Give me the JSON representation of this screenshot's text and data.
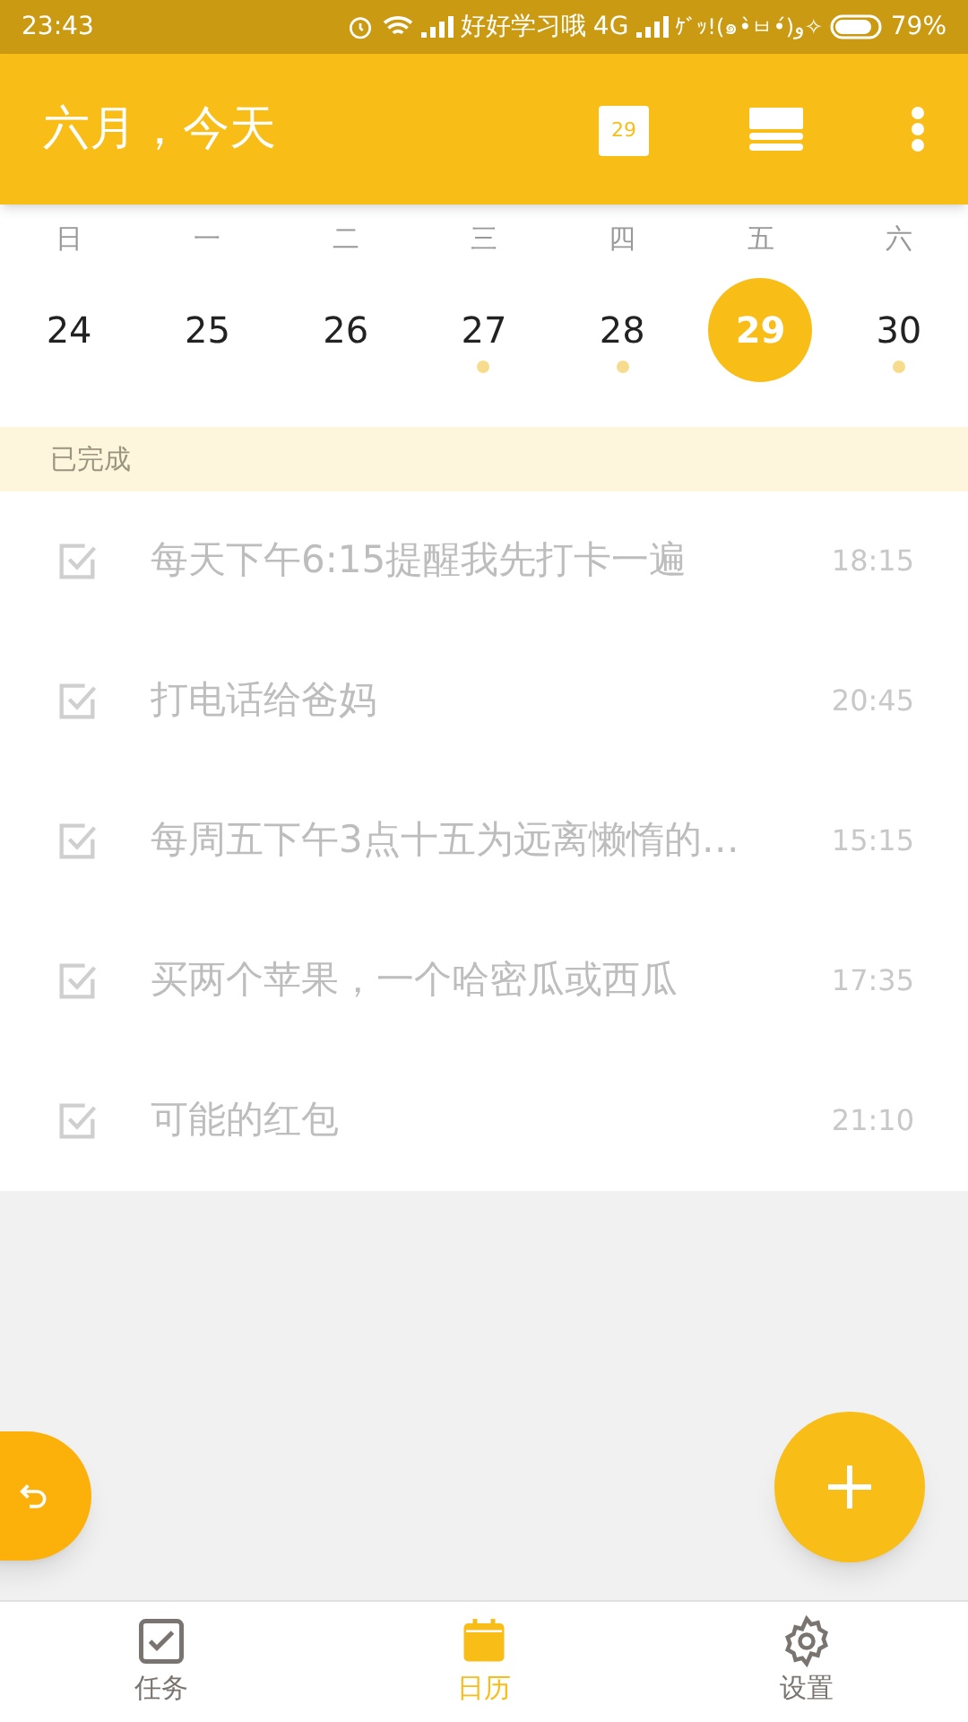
{
  "status_bar": {
    "time": "23:43",
    "carrier": "好好学习哦",
    "network": "4G",
    "nickname": "ｹﾞｯ!(๑•̀ㅂ•́)و✧",
    "battery": "79%"
  },
  "app_bar": {
    "title": "六月，今天",
    "calendar_badge": "29"
  },
  "week": {
    "weekdays": [
      "日",
      "一",
      "二",
      "三",
      "四",
      "五",
      "六"
    ],
    "days": [
      {
        "label": "24",
        "selected": false,
        "has_tasks": false
      },
      {
        "label": "25",
        "selected": false,
        "has_tasks": false
      },
      {
        "label": "26",
        "selected": false,
        "has_tasks": false
      },
      {
        "label": "27",
        "selected": false,
        "has_tasks": true
      },
      {
        "label": "28",
        "selected": false,
        "has_tasks": true
      },
      {
        "label": "29",
        "selected": true,
        "has_tasks": false
      },
      {
        "label": "30",
        "selected": false,
        "has_tasks": true
      }
    ]
  },
  "section": {
    "title": "已完成"
  },
  "tasks": [
    {
      "title": "每天下午6:15提醒我先打卡一遍",
      "time": "18:15",
      "checked": true
    },
    {
      "title": "打电话给爸妈",
      "time": "20:45",
      "checked": true
    },
    {
      "title": "每周五下午3点十五为远离懒惰的…",
      "time": "15:15",
      "checked": true
    },
    {
      "title": "买两个苹果，一个哈密瓜或西瓜",
      "time": "17:35",
      "checked": true
    },
    {
      "title": "可能的红包",
      "time": "21:10",
      "checked": true
    }
  ],
  "bottom_nav": [
    {
      "label": "任务",
      "kind": "tasks",
      "selected": false
    },
    {
      "label": "日历",
      "kind": "calendar",
      "selected": true
    },
    {
      "label": "设置",
      "kind": "settings",
      "selected": false
    }
  ]
}
